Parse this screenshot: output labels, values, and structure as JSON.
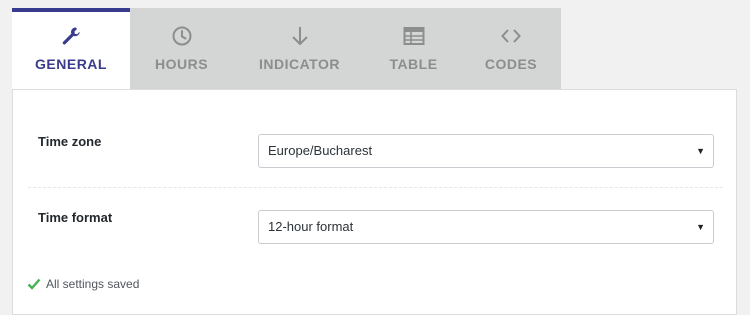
{
  "tabs": [
    {
      "label": "GENERAL",
      "icon": "wrench-icon",
      "active": true
    },
    {
      "label": "HOURS",
      "icon": "clock-icon",
      "active": false
    },
    {
      "label": "INDICATOR",
      "icon": "arrow-down-icon",
      "active": false
    },
    {
      "label": "TABLE",
      "icon": "table-icon",
      "active": false
    },
    {
      "label": "CODES",
      "icon": "code-icon",
      "active": false
    }
  ],
  "settings": {
    "timezone_label": "Time zone",
    "timezone_value": "Europe/Bucharest",
    "timeformat_label": "Time format",
    "timeformat_value": "12-hour format"
  },
  "status": {
    "saved_text": "All settings saved"
  },
  "colors": {
    "accent": "#393c8e",
    "tab_bg": "#d3d6d4",
    "tab_inactive_text": "#8b8e8d",
    "success": "#46b450"
  }
}
